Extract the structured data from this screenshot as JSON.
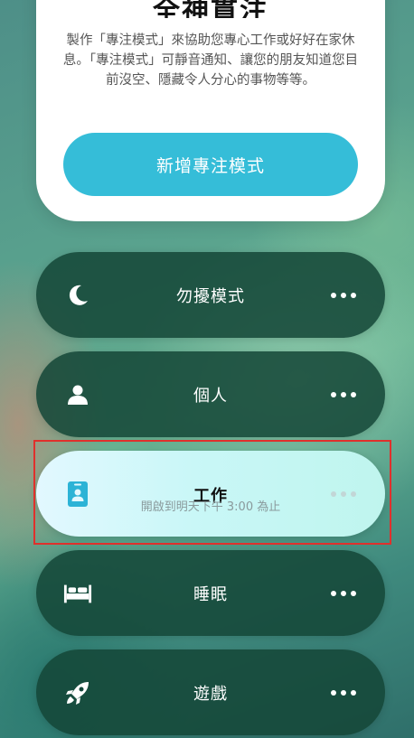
{
  "sheet": {
    "title": "全神貫注",
    "description": "製作「專注模式」來協助您專心工作或好好在家休息。「專注模式」可靜音通知、讓您的朋友知道您目前沒空、隱藏令人分心的事物等等。",
    "button_label": "新增專注模式"
  },
  "modes": [
    {
      "label": "勿擾模式",
      "icon": "moon-icon"
    },
    {
      "label": "個人",
      "icon": "person-icon"
    },
    {
      "label": "工作",
      "icon": "id-badge-icon",
      "sublabel": "開啟到明天下午 3:00 為止",
      "active": true
    },
    {
      "label": "睡眠",
      "icon": "bed-icon"
    },
    {
      "label": "遊戲",
      "icon": "rocket-icon"
    }
  ],
  "colors": {
    "accent": "#35bdd8",
    "mode_bg": "#14463a",
    "highlight": "#e0302c"
  }
}
